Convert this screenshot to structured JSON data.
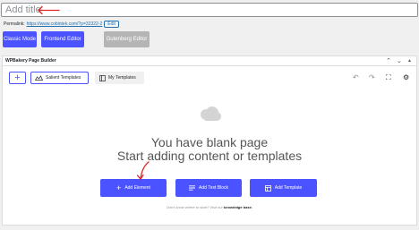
{
  "post": {
    "title_placeholder": "Add title",
    "permalink_label": "Permalink:",
    "permalink_url": "https://www.cobintek.com/?p=32322-2",
    "permalink_edit": "Edit"
  },
  "editor_modes": {
    "classic": "Classic Mode",
    "frontend": "Frontend Editor",
    "gutenberg": "Gutenberg Editor"
  },
  "builder": {
    "title": "WPBakery Page Builder",
    "toolbar": {
      "salient_templates": "Salient Templates",
      "my_templates": "My Templates"
    },
    "blank": {
      "title": "You have blank page",
      "subtitle": "Start adding content or templates"
    },
    "actions": {
      "add_element": "Add Element",
      "add_text_block": "Add Text Block",
      "add_template": "Add Template"
    },
    "help_prefix": "Don't know where to start? Visit our ",
    "help_link": "knowledge base."
  },
  "colors": {
    "accent": "#4b52ff",
    "annotation": "#e02424",
    "disabled": "#b5b5b5"
  }
}
